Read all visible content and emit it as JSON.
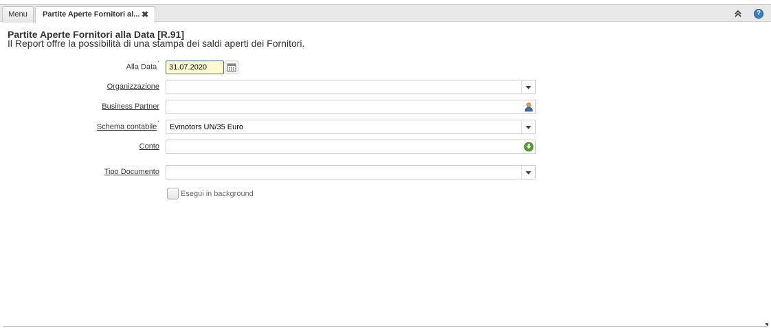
{
  "tabs": {
    "menu_label": "Menu",
    "active_label": "Partite Aperte Fornitori al...",
    "close_glyph": "✖"
  },
  "header_controls": {
    "collapse_glyph": "⌃",
    "help_glyph": "?"
  },
  "report": {
    "title": "Partite Aperte Fornitori alla Data [R.91]",
    "description": "Il Report offre la possibilità di una stampa dei saldi aperti dei Fornitori."
  },
  "form": {
    "alla_data": {
      "label": "Alla Data",
      "value": "31.07.2020",
      "required_mark": "*"
    },
    "organizzazione": {
      "label": "Organizzazione",
      "value": ""
    },
    "business_partner": {
      "label": "Business Partner",
      "value": ""
    },
    "schema_contabile": {
      "label": "Schema contabile",
      "value": "Evmotors UN/35 Euro",
      "required_mark": "*"
    },
    "conto": {
      "label": "Conto",
      "value": ""
    },
    "tipo_documento": {
      "label": "Tipo Documento",
      "value": ""
    },
    "background": {
      "label": "Esegui in background",
      "checked": false
    }
  },
  "icons": {
    "calendar": "calendar-icon",
    "business_partner": "person-icon",
    "conto": "green-arrow-icon",
    "dropdown": "chevron-down-icon"
  },
  "colors": {
    "date_field_bg": "#fffbd0",
    "date_field_border": "#3a6ea5",
    "help_blue": "#3a7fc4",
    "account_green": "#5aa02c"
  }
}
